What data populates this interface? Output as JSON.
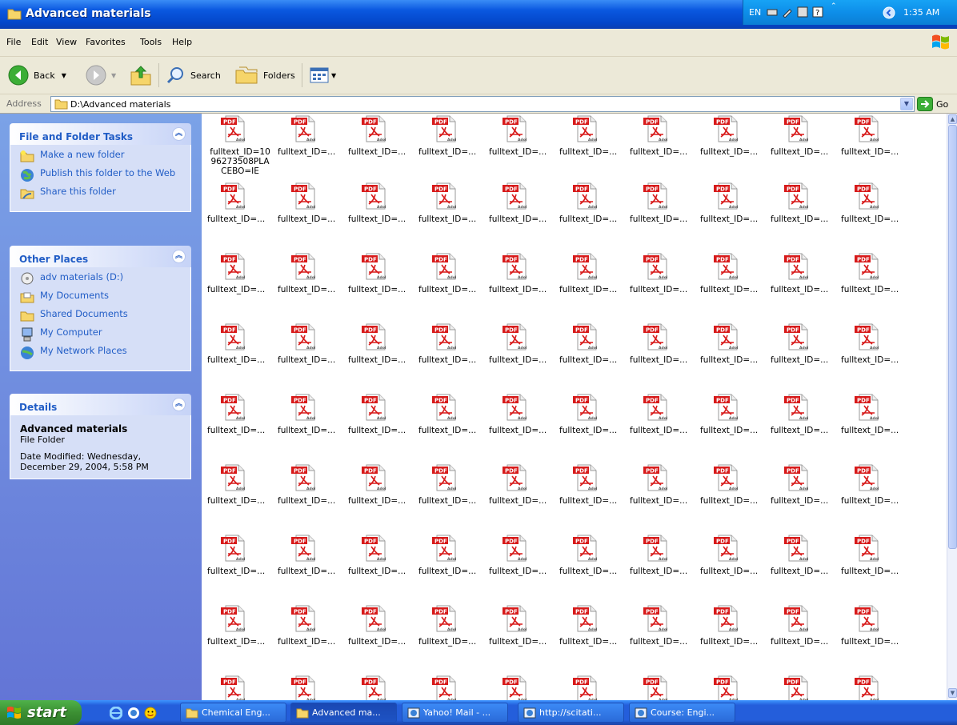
{
  "window": {
    "title": "Advanced materials"
  },
  "menu": [
    "File",
    "Edit",
    "View",
    "Favorites",
    "Tools",
    "Help"
  ],
  "toolbar": {
    "back": "Back",
    "search": "Search",
    "folders": "Folders"
  },
  "address": {
    "label": "Address",
    "path": "D:\\Advanced materials",
    "go": "Go"
  },
  "tasks": {
    "file_folder": {
      "title": "File and Folder Tasks",
      "items": [
        "Make a new folder",
        "Publish this folder to the Web",
        "Share this folder"
      ]
    },
    "other_places": {
      "title": "Other Places",
      "items": [
        "adv materials (D:)",
        "My Documents",
        "Shared Documents",
        "My Computer",
        "My Network Places"
      ]
    },
    "details": {
      "title": "Details",
      "name": "Advanced materials",
      "type": "File Folder",
      "modified": "Date Modified: Wednesday, December 29, 2004, 5:58 PM"
    }
  },
  "files": {
    "selected_label": "fulltext_ID=10\n96273508PLA\nCEBO=IE",
    "label": "fulltext_ID=...",
    "icon_badge": "PDF",
    "icon_brand": "Adobe",
    "columns": 10,
    "rows": 9
  },
  "taskbar": {
    "start": "start",
    "tasks": [
      "Chemical Eng...",
      "Advanced ma...",
      "Yahoo! Mail - ...",
      "http://scitati...",
      "Course: Engi..."
    ],
    "active_index": 1,
    "tray": {
      "lang": "EN",
      "time": "1:35 AM"
    }
  },
  "colors": {
    "title_blue": "#0a58e0",
    "taskpane_blue": "#6f8fe0",
    "link_blue": "#215dc6",
    "start_green": "#3c8f33",
    "pdf_red": "#d71a1a"
  }
}
